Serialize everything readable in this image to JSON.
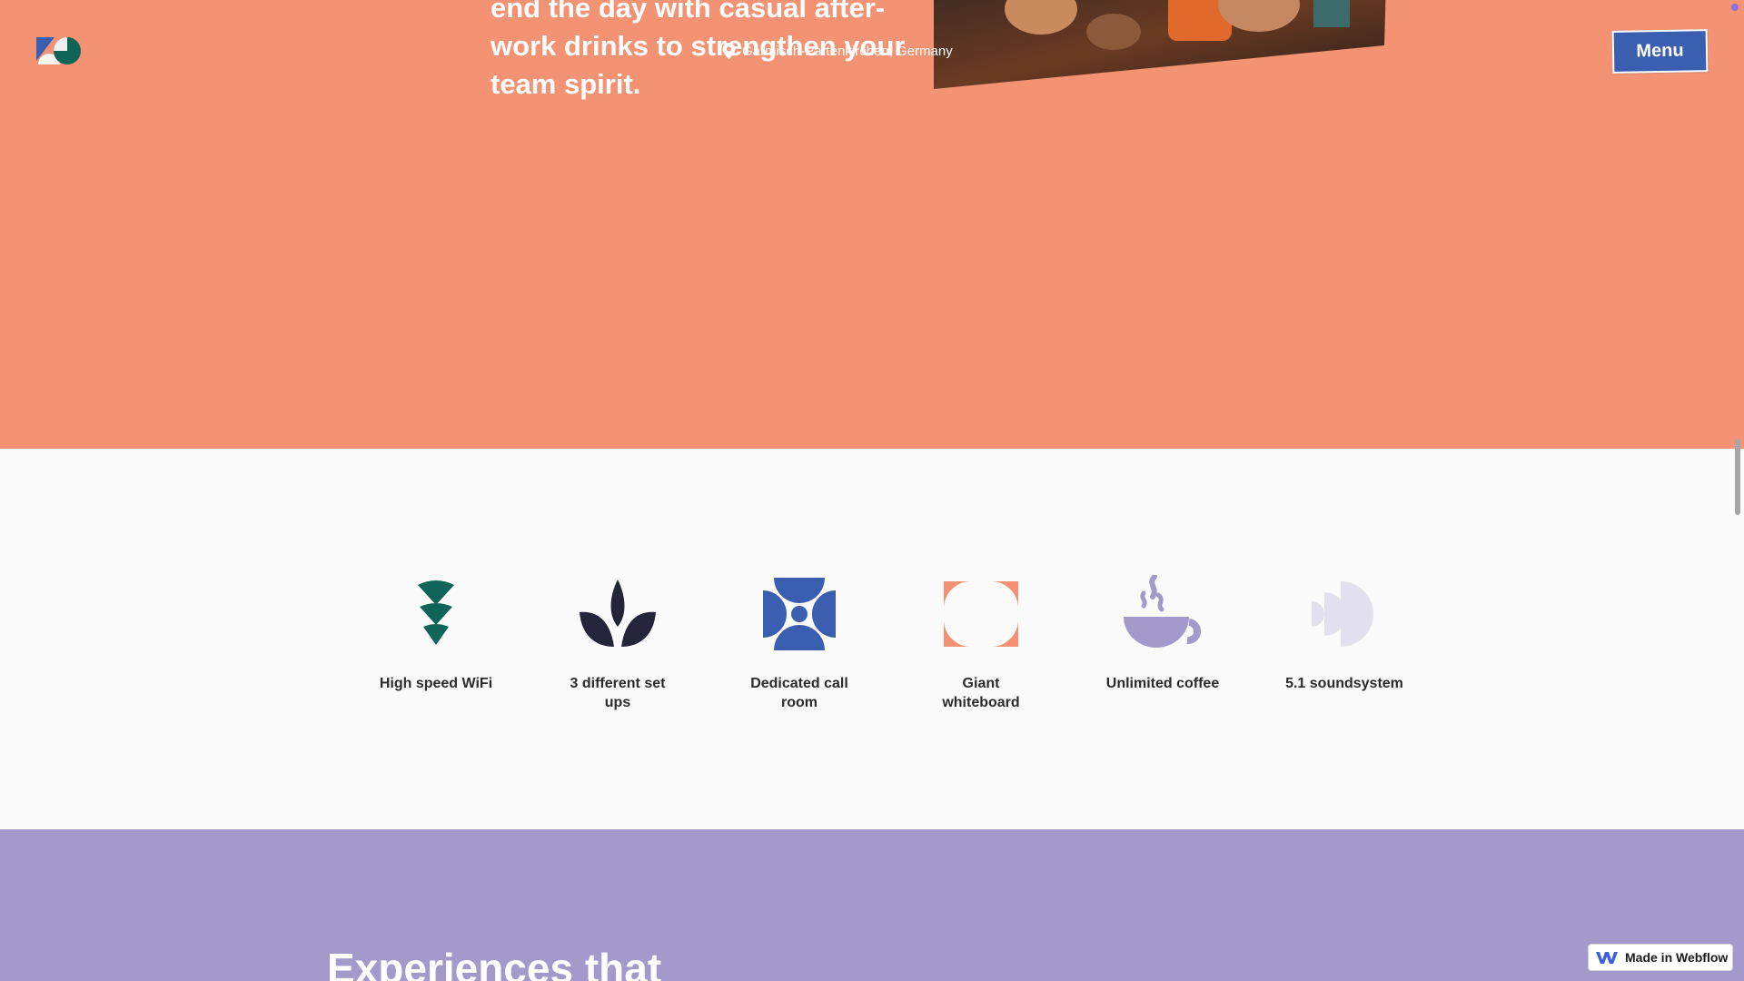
{
  "hero": {
    "text": "end the day with casual after-work drinks to strengthen your team spirit.",
    "location": "Garmisch-Partenkirchen, Germany",
    "menu_label": "Menu",
    "background": "#f39373"
  },
  "icons": {
    "logo": "brand-logo",
    "location": "map-pin-icon"
  },
  "amenities": [
    {
      "label": "High speed WiFi",
      "icon": "wifi-icon",
      "color": "#0e6456"
    },
    {
      "label": "3 different set ups",
      "icon": "leaf-icon",
      "color": "#24243a"
    },
    {
      "label": "Dedicated call room",
      "icon": "call-room-icon",
      "color": "#3b5fb0"
    },
    {
      "label": "Giant whiteboard",
      "icon": "whiteboard-icon",
      "color": "#f39373"
    },
    {
      "label": "Unlimited coffee",
      "icon": "coffee-icon",
      "color": "#a39acb"
    },
    {
      "label": "5.1 soundsystem",
      "icon": "sound-icon",
      "color": "#e2e0ee"
    }
  ],
  "experiences": {
    "heading": "Experiences that",
    "background": "#a39acb"
  },
  "badge": {
    "label": "Made in Webflow"
  }
}
